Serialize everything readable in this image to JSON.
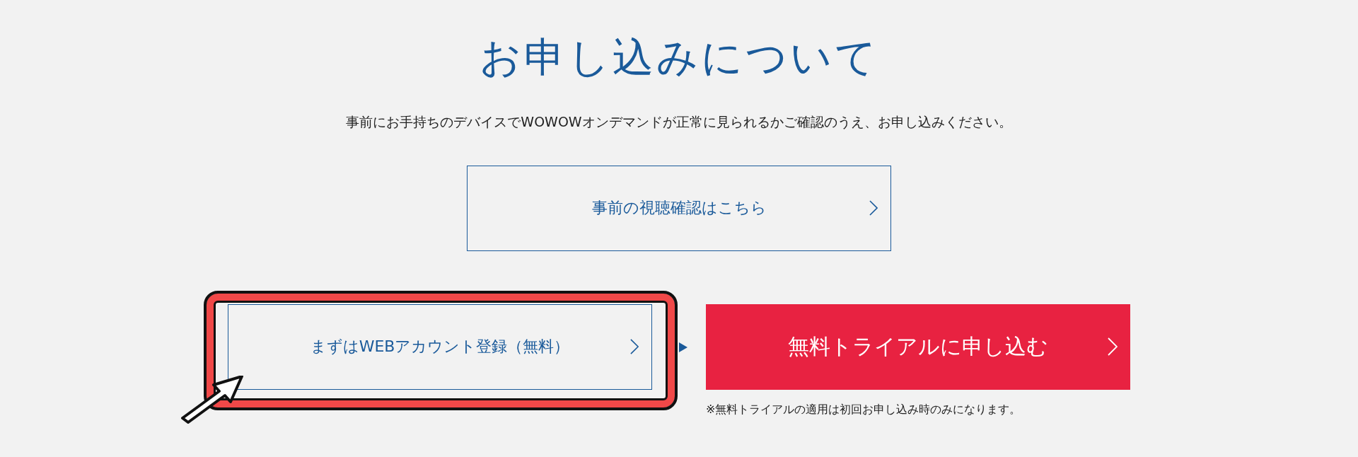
{
  "title": "お申し込みについて",
  "lead": "事前にお手持ちのデバイスでWOWOWオンデマンドが正常に見られるかご確認のうえ、お申し込みください。",
  "check_button": {
    "label": "事前の視聴確認はこちら",
    "kind": "outline"
  },
  "actions": [
    {
      "label": "まずはWEBアカウント登録（無料）",
      "kind": "outline",
      "highlighted": true
    },
    {
      "label": "無料トライアルに申し込む",
      "kind": "filled",
      "highlighted": false,
      "note": "※無料トライアルの適用は初回お申し込み時のみになります。"
    }
  ]
}
